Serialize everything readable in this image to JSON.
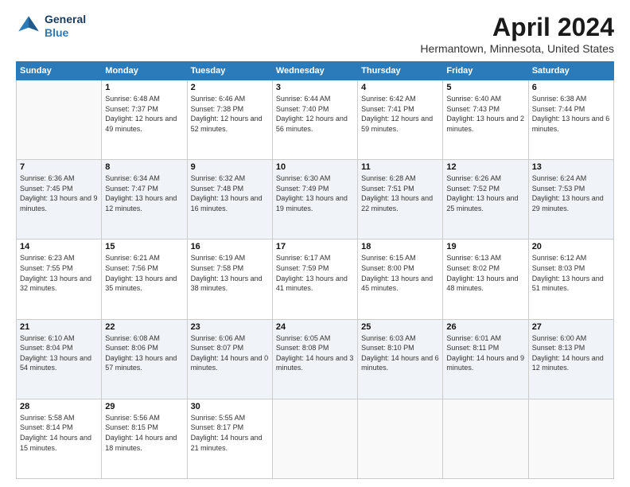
{
  "header": {
    "logo": {
      "line1": "General",
      "line2": "Blue"
    },
    "title": "April 2024",
    "subtitle": "Hermantown, Minnesota, United States"
  },
  "weekdays": [
    "Sunday",
    "Monday",
    "Tuesday",
    "Wednesday",
    "Thursday",
    "Friday",
    "Saturday"
  ],
  "weeks": [
    [
      {
        "day": null
      },
      {
        "day": "1",
        "rise": "6:48 AM",
        "set": "7:37 PM",
        "daylight": "12 hours and 49 minutes."
      },
      {
        "day": "2",
        "rise": "6:46 AM",
        "set": "7:38 PM",
        "daylight": "12 hours and 52 minutes."
      },
      {
        "day": "3",
        "rise": "6:44 AM",
        "set": "7:40 PM",
        "daylight": "12 hours and 56 minutes."
      },
      {
        "day": "4",
        "rise": "6:42 AM",
        "set": "7:41 PM",
        "daylight": "12 hours and 59 minutes."
      },
      {
        "day": "5",
        "rise": "6:40 AM",
        "set": "7:43 PM",
        "daylight": "13 hours and 2 minutes."
      },
      {
        "day": "6",
        "rise": "6:38 AM",
        "set": "7:44 PM",
        "daylight": "13 hours and 6 minutes."
      }
    ],
    [
      {
        "day": "7",
        "rise": "6:36 AM",
        "set": "7:45 PM",
        "daylight": "13 hours and 9 minutes."
      },
      {
        "day": "8",
        "rise": "6:34 AM",
        "set": "7:47 PM",
        "daylight": "13 hours and 12 minutes."
      },
      {
        "day": "9",
        "rise": "6:32 AM",
        "set": "7:48 PM",
        "daylight": "13 hours and 16 minutes."
      },
      {
        "day": "10",
        "rise": "6:30 AM",
        "set": "7:49 PM",
        "daylight": "13 hours and 19 minutes."
      },
      {
        "day": "11",
        "rise": "6:28 AM",
        "set": "7:51 PM",
        "daylight": "13 hours and 22 minutes."
      },
      {
        "day": "12",
        "rise": "6:26 AM",
        "set": "7:52 PM",
        "daylight": "13 hours and 25 minutes."
      },
      {
        "day": "13",
        "rise": "6:24 AM",
        "set": "7:53 PM",
        "daylight": "13 hours and 29 minutes."
      }
    ],
    [
      {
        "day": "14",
        "rise": "6:23 AM",
        "set": "7:55 PM",
        "daylight": "13 hours and 32 minutes."
      },
      {
        "day": "15",
        "rise": "6:21 AM",
        "set": "7:56 PM",
        "daylight": "13 hours and 35 minutes."
      },
      {
        "day": "16",
        "rise": "6:19 AM",
        "set": "7:58 PM",
        "daylight": "13 hours and 38 minutes."
      },
      {
        "day": "17",
        "rise": "6:17 AM",
        "set": "7:59 PM",
        "daylight": "13 hours and 41 minutes."
      },
      {
        "day": "18",
        "rise": "6:15 AM",
        "set": "8:00 PM",
        "daylight": "13 hours and 45 minutes."
      },
      {
        "day": "19",
        "rise": "6:13 AM",
        "set": "8:02 PM",
        "daylight": "13 hours and 48 minutes."
      },
      {
        "day": "20",
        "rise": "6:12 AM",
        "set": "8:03 PM",
        "daylight": "13 hours and 51 minutes."
      }
    ],
    [
      {
        "day": "21",
        "rise": "6:10 AM",
        "set": "8:04 PM",
        "daylight": "13 hours and 54 minutes."
      },
      {
        "day": "22",
        "rise": "6:08 AM",
        "set": "8:06 PM",
        "daylight": "13 hours and 57 minutes."
      },
      {
        "day": "23",
        "rise": "6:06 AM",
        "set": "8:07 PM",
        "daylight": "14 hours and 0 minutes."
      },
      {
        "day": "24",
        "rise": "6:05 AM",
        "set": "8:08 PM",
        "daylight": "14 hours and 3 minutes."
      },
      {
        "day": "25",
        "rise": "6:03 AM",
        "set": "8:10 PM",
        "daylight": "14 hours and 6 minutes."
      },
      {
        "day": "26",
        "rise": "6:01 AM",
        "set": "8:11 PM",
        "daylight": "14 hours and 9 minutes."
      },
      {
        "day": "27",
        "rise": "6:00 AM",
        "set": "8:13 PM",
        "daylight": "14 hours and 12 minutes."
      }
    ],
    [
      {
        "day": "28",
        "rise": "5:58 AM",
        "set": "8:14 PM",
        "daylight": "14 hours and 15 minutes."
      },
      {
        "day": "29",
        "rise": "5:56 AM",
        "set": "8:15 PM",
        "daylight": "14 hours and 18 minutes."
      },
      {
        "day": "30",
        "rise": "5:55 AM",
        "set": "8:17 PM",
        "daylight": "14 hours and 21 minutes."
      },
      {
        "day": null
      },
      {
        "day": null
      },
      {
        "day": null
      },
      {
        "day": null
      }
    ]
  ]
}
